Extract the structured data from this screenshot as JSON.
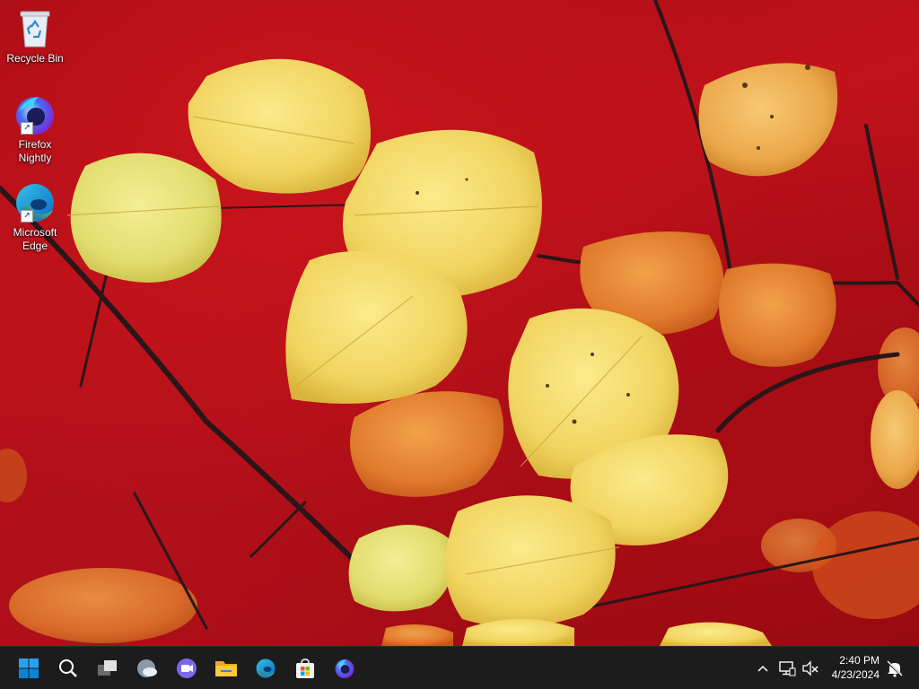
{
  "desktop": {
    "icons": [
      {
        "label": "Recycle Bin",
        "icon": "recycle-bin-icon"
      },
      {
        "label": "Firefox Nightly",
        "icon": "firefox-nightly-icon"
      },
      {
        "label": "Microsoft Edge",
        "icon": "microsoft-edge-icon"
      }
    ]
  },
  "taskbar": {
    "pinned": [
      {
        "name": "start",
        "icon": "windows-start-icon"
      },
      {
        "name": "search",
        "icon": "search-icon"
      },
      {
        "name": "task-view",
        "icon": "task-view-icon"
      },
      {
        "name": "widgets",
        "icon": "weather-widget-icon"
      },
      {
        "name": "teams-chat",
        "icon": "teams-chat-icon"
      },
      {
        "name": "file-explorer",
        "icon": "file-explorer-icon"
      },
      {
        "name": "edge",
        "icon": "microsoft-edge-icon"
      },
      {
        "name": "store",
        "icon": "microsoft-store-icon"
      },
      {
        "name": "firefox-nightly",
        "icon": "firefox-nightly-icon"
      }
    ],
    "tray": {
      "time": "2:40 PM",
      "date": "4/23/2024"
    }
  },
  "colors": {
    "taskbar_bg": "#1c1c1c",
    "windows_blue": "#0a84d8"
  }
}
